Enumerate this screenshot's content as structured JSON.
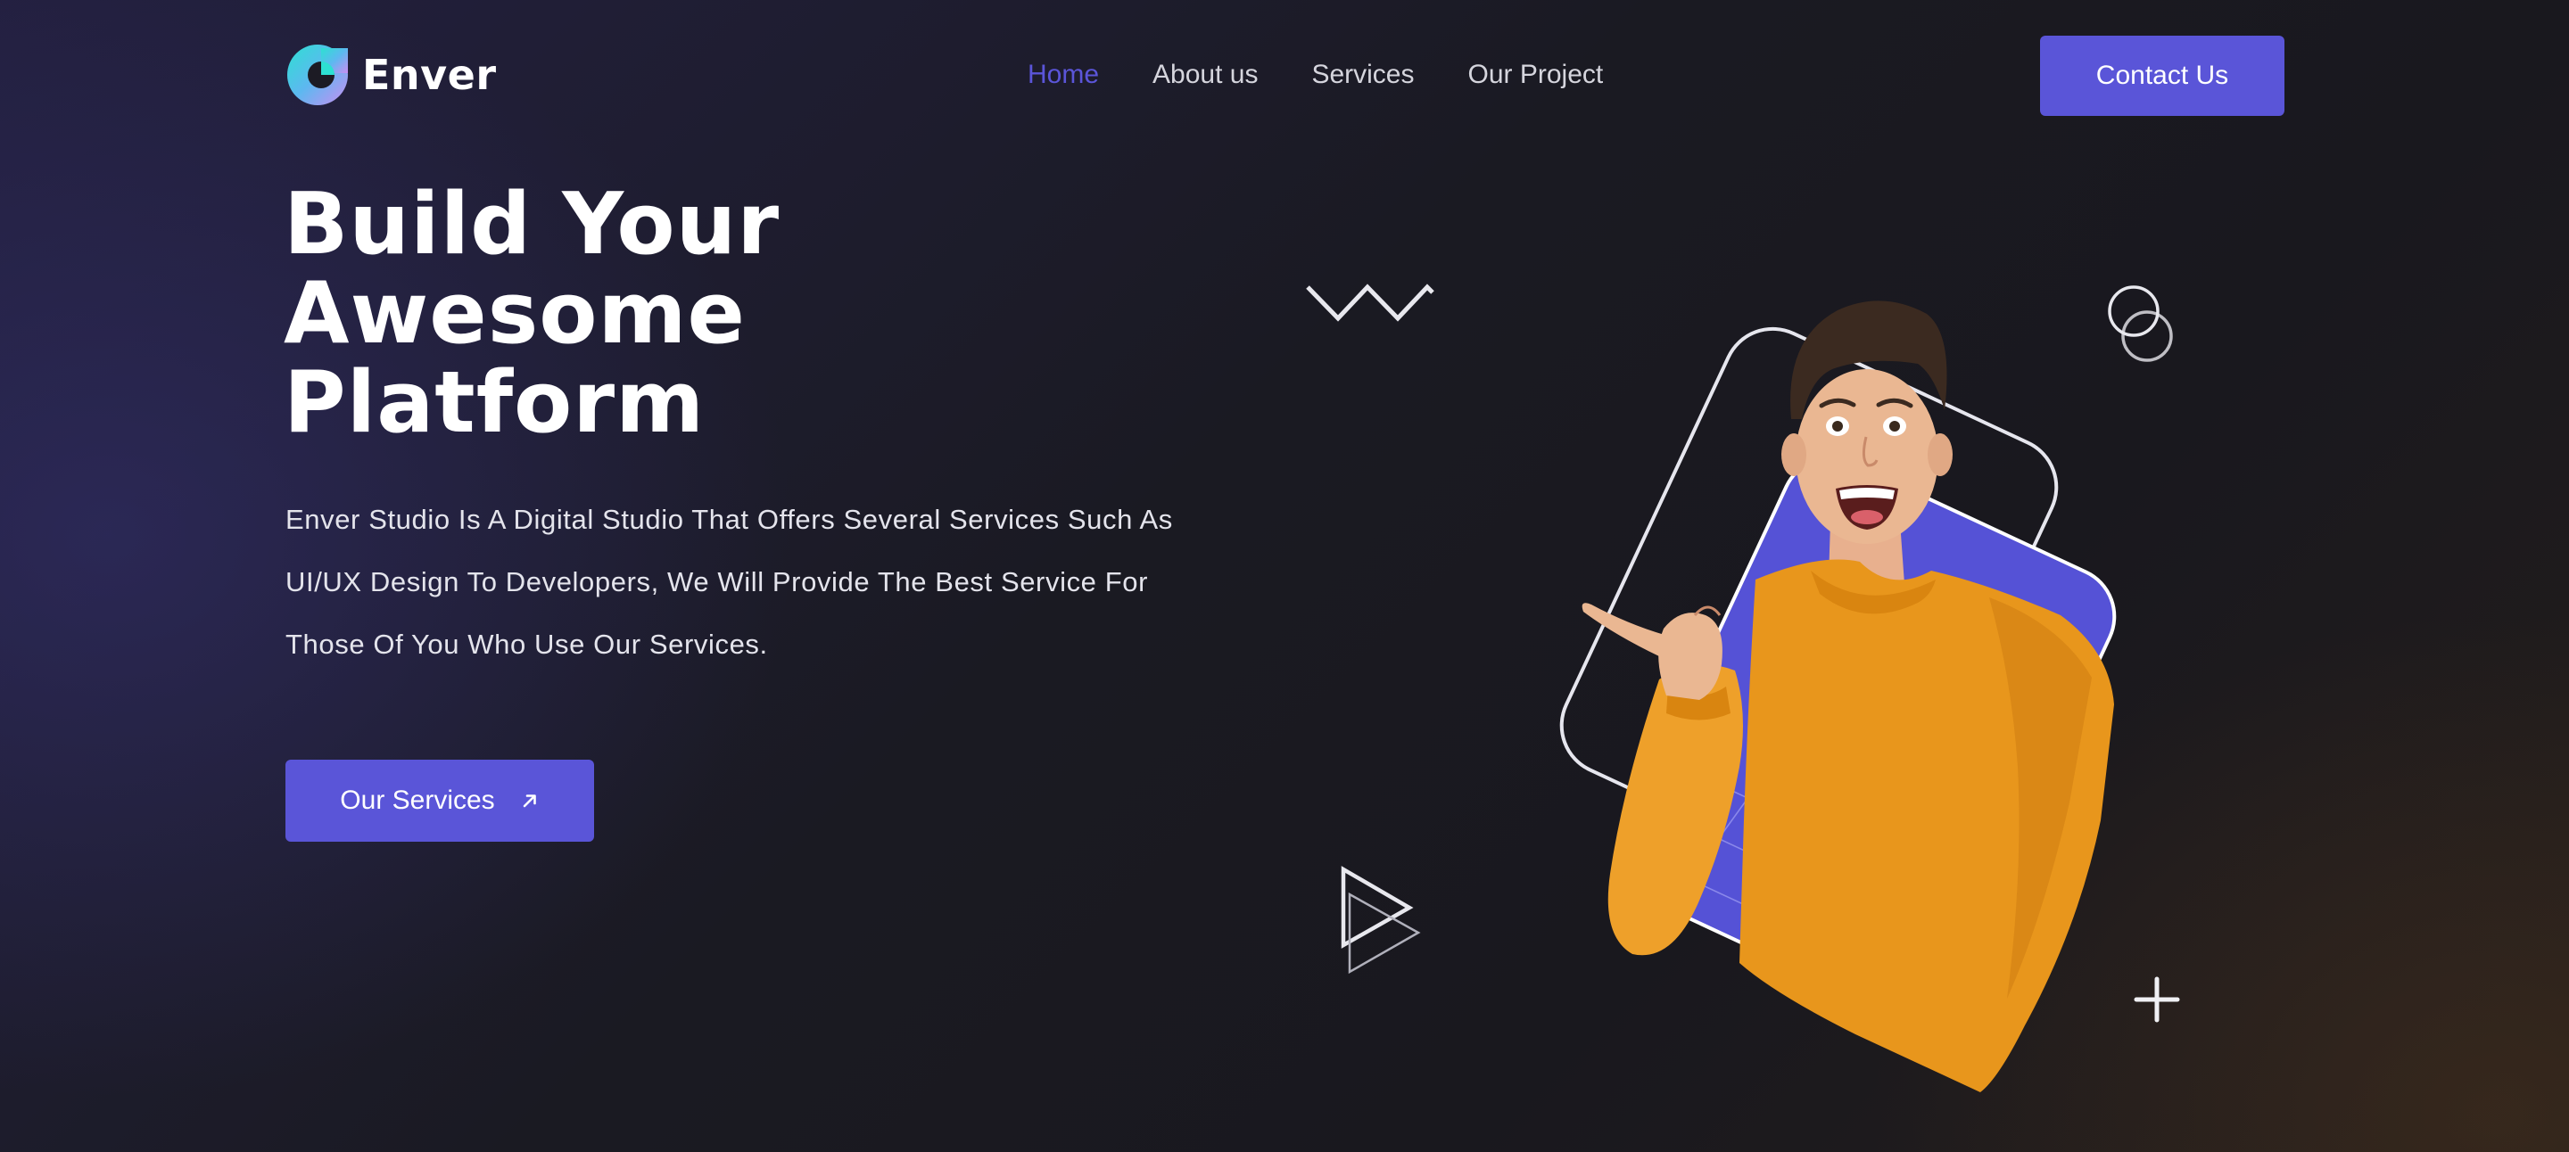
{
  "brand": {
    "name": "Enver",
    "logo_icon": "ring-logo-icon"
  },
  "nav": {
    "items": [
      {
        "label": "Home",
        "active": true
      },
      {
        "label": "About us",
        "active": false
      },
      {
        "label": "Services",
        "active": false
      },
      {
        "label": "Our Project",
        "active": false
      }
    ],
    "contact_label": "Contact Us"
  },
  "hero": {
    "title_lines": [
      "Build Your",
      "Awesome",
      "Platform"
    ],
    "description_lines": [
      "Enver Studio Is A Digital Studio That Offers Several Services Such As",
      "UI/UX Design To Developers, We Will Provide The Best Service For",
      "Those Of You Who Use Our Services."
    ],
    "cta_label": "Our Services",
    "cta_icon": "arrow-up-right-icon"
  },
  "illustration": {
    "image": "excited-man-in-orange-sweater-pointing",
    "decor_icons": [
      "zigzag-icon",
      "double-circle-icon",
      "double-triangle-icon",
      "plus-icon"
    ]
  },
  "colors": {
    "accent": "#5a55d8",
    "active_nav": "#5b55d9",
    "background": "#1b1a22",
    "sweater": "#e8971e"
  }
}
